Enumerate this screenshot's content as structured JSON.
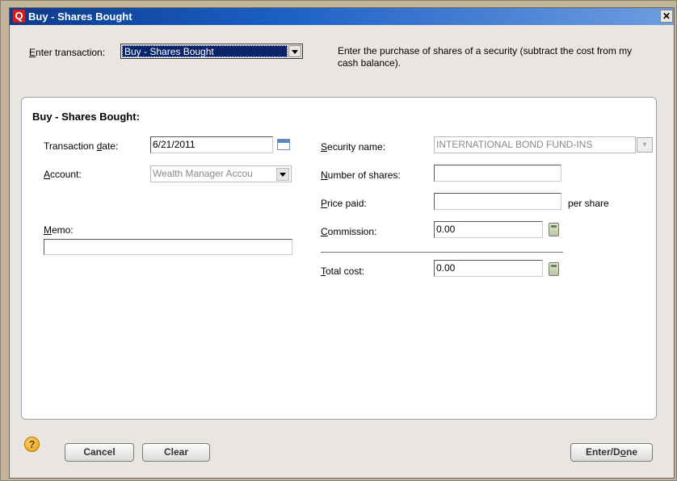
{
  "window": {
    "title": "Buy - Shares Bought",
    "logo": "Q",
    "close_glyph": "✕"
  },
  "transaction": {
    "label_underlined": "E",
    "label_rest": "nter transaction:",
    "selected": "Buy - Shares Bought",
    "description": "Enter the purchase of shares of a security (subtract the cost from my cash balance)."
  },
  "panel": {
    "title": "Buy - Shares Bought:"
  },
  "fields": {
    "transaction_date": {
      "label_pre": "Transaction ",
      "label_u": "d",
      "label_post": "ate:",
      "value": "6/21/2011"
    },
    "account": {
      "label_u": "A",
      "label_post": "ccount:",
      "value": "Wealth Manager Accou"
    },
    "memo": {
      "label_u": "M",
      "label_post": "emo:",
      "value": ""
    },
    "security_name": {
      "label_u": "S",
      "label_post": "ecurity name:",
      "value": "INTERNATIONAL BOND FUND-INS"
    },
    "number_of_shares": {
      "label_u": "N",
      "label_post": "umber of shares:",
      "value": ""
    },
    "price_paid": {
      "label_u": "P",
      "label_post": "rice paid:",
      "value": "",
      "suffix": "per share"
    },
    "commission": {
      "label_u": "C",
      "label_post": "ommission:",
      "value": "0.00"
    },
    "total_cost": {
      "label_u": "T",
      "label_post": "otal cost:",
      "value": "0.00"
    }
  },
  "buttons": {
    "help": "?",
    "cancel": "Cancel",
    "clear": "Clear",
    "enter_done_pre": "Enter/D",
    "enter_done_u": "o",
    "enter_done_post": "ne"
  },
  "icons": [
    "q-logo-icon",
    "close-icon",
    "chevron-down-icon",
    "calendar-icon",
    "calculator-icon",
    "help-icon"
  ]
}
